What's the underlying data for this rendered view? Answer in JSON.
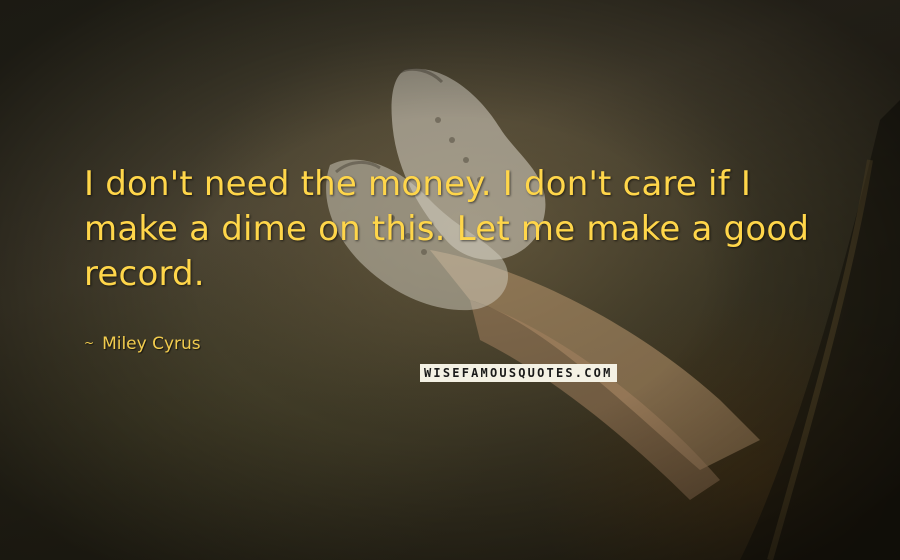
{
  "quote": {
    "text": "I don't need the money. I don't care if I make a dime on this. Let me make a good record.",
    "author": "Miley Cyrus",
    "author_prefix": "~"
  },
  "watermark": {
    "text": "WISEFAMOUSQUOTES.COM"
  },
  "colors": {
    "quote_text": "#ffd64a",
    "author_text": "#f2cc4e",
    "background": "#3d3a2a"
  }
}
